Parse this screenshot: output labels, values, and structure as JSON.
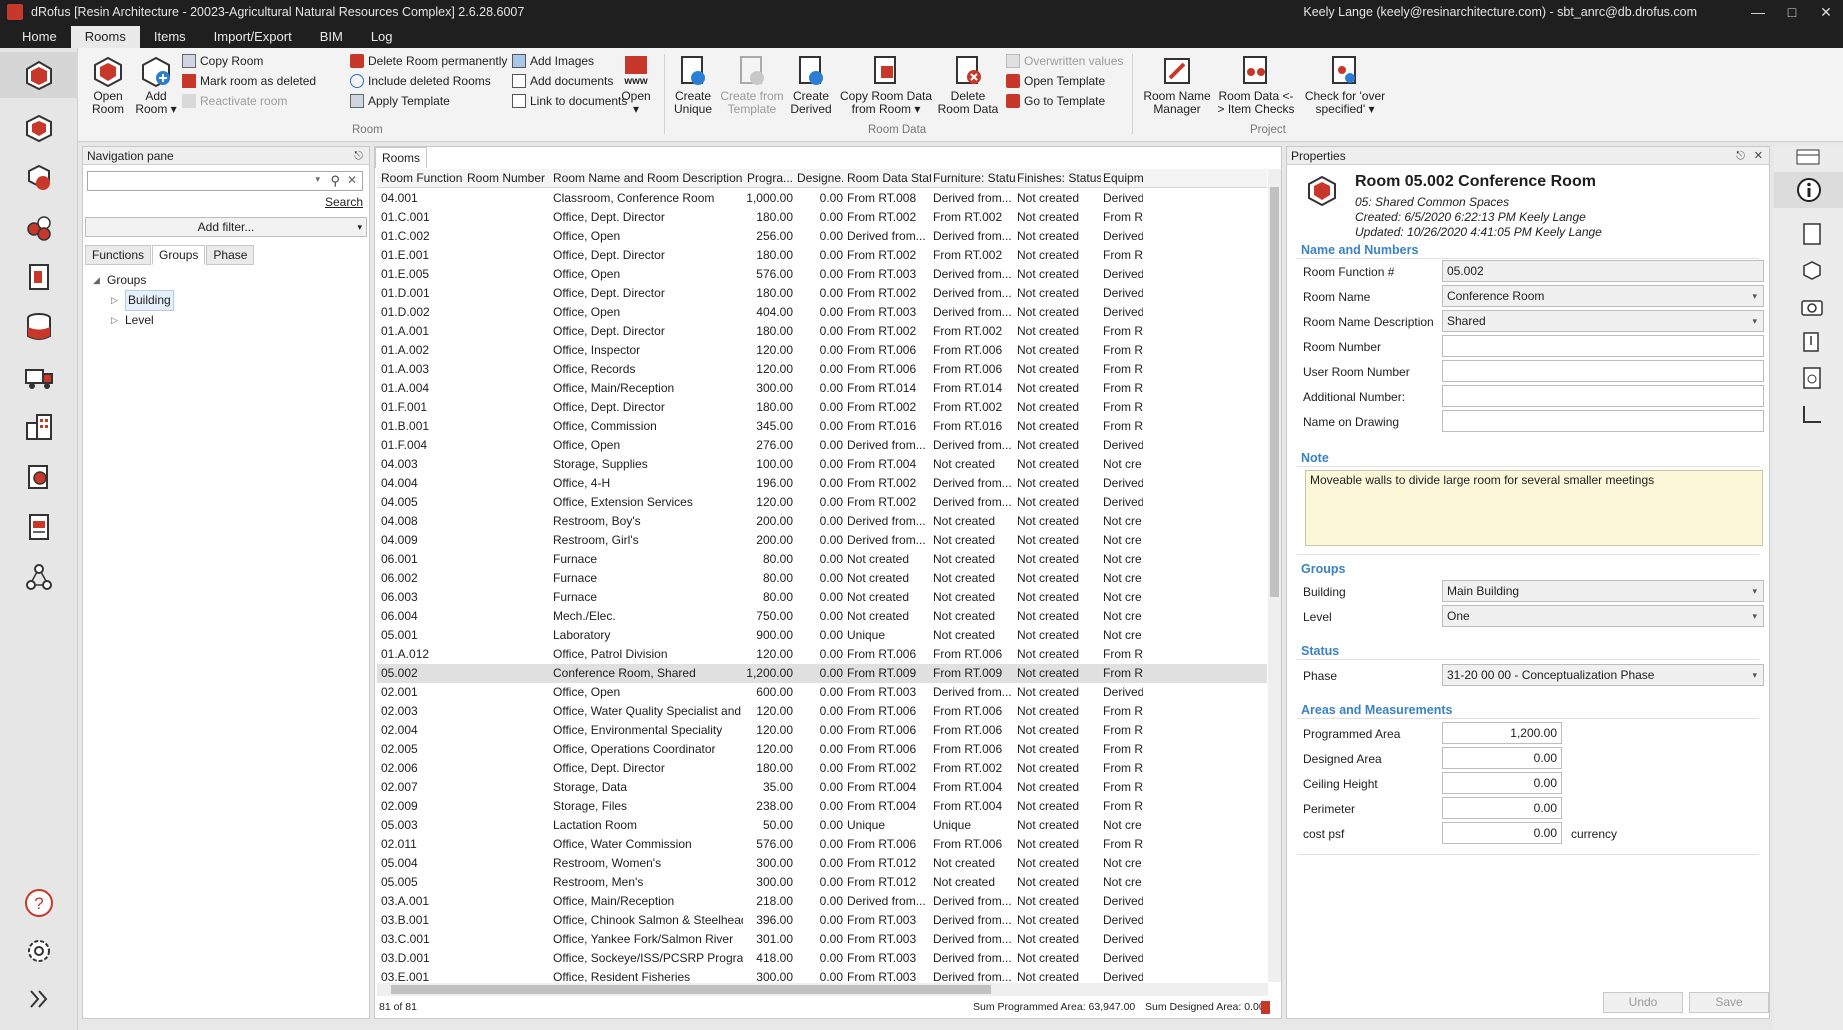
{
  "app": {
    "title": "dRofus [Resin Architecture - 20023-Agricultural Natural Resources Complex] 2.6.28.6007",
    "user": "Keely Lange (keely@resinarchitecture.com) - sbt_anrc@db.drofus.com",
    "brand_color": "#c8382a"
  },
  "menu": {
    "tabs": [
      "Home",
      "Rooms",
      "Items",
      "Import/Export",
      "BIM",
      "Log"
    ]
  },
  "ribbon": {
    "open_room": "Open Room",
    "add_room": "Add Room",
    "copy_room": "Copy Room",
    "mark_deleted": "Mark room as deleted",
    "reactivate": "Reactivate room",
    "delete_perm": "Delete Room permanently",
    "include_deleted": "Include deleted Rooms",
    "apply_template": "Apply Template",
    "add_images": "Add Images",
    "add_documents": "Add documents",
    "link_documents": "Link to documents",
    "www_open": "Open",
    "group_room": "Room",
    "create_unique": "Create Unique",
    "create_from_template": "Create from Template",
    "create_derived": "Create Derived",
    "copy_room_data": "Copy Room Data from Room",
    "delete_room_data": "Delete Room Data",
    "overwritten_values": "Overwritten values",
    "open_template": "Open Template",
    "go_to_template": "Go to Template",
    "group_room_data": "Room Data",
    "room_name_manager": "Room Name Manager",
    "room_data_item_checks": "Room Data <-> Item Checks",
    "check_over_specified": "Check for 'over specified'",
    "group_project": "Project"
  },
  "nav": {
    "title": "Navigation pane",
    "search_placeholder": "",
    "search_link": "Search",
    "add_filter": "Add filter...",
    "tabs": [
      "Functions",
      "Groups",
      "Phase"
    ],
    "tree_root": "Groups",
    "tree_items": [
      "Building",
      "Level"
    ]
  },
  "rooms": {
    "tab": "Rooms",
    "columns": [
      "Room Function #",
      "Room Number",
      "Room Name and Room Description",
      "Progra...",
      "Designe...",
      "Room Data Stat...",
      "Furniture: Status",
      "Finishes: Status",
      "Equipm"
    ],
    "rows": [
      [
        "04.001",
        "",
        "Classroom, Conference Room",
        "1,000.00",
        "0.00",
        "From RT.008",
        "Derived from...",
        "Not created",
        "Derived"
      ],
      [
        "01.C.001",
        "",
        "Office, Dept. Director",
        "180.00",
        "0.00",
        "From RT.002",
        "From RT.002",
        "Not created",
        "From R"
      ],
      [
        "01.C.002",
        "",
        "Office, Open",
        "256.00",
        "0.00",
        "Derived from...",
        "Derived from...",
        "Not created",
        "Derived"
      ],
      [
        "01.E.001",
        "",
        "Office, Dept. Director",
        "180.00",
        "0.00",
        "From RT.002",
        "From RT.002",
        "Not created",
        "From R"
      ],
      [
        "01.E.005",
        "",
        "Office, Open",
        "576.00",
        "0.00",
        "From RT.003",
        "Derived from...",
        "Not created",
        "Derived"
      ],
      [
        "01.D.001",
        "",
        "Office, Dept. Director",
        "180.00",
        "0.00",
        "From RT.002",
        "Derived from...",
        "Not created",
        "Derived"
      ],
      [
        "01.D.002",
        "",
        "Office, Open",
        "404.00",
        "0.00",
        "From RT.003",
        "Derived from...",
        "Not created",
        "Derived"
      ],
      [
        "01.A.001",
        "",
        "Office, Dept. Director",
        "180.00",
        "0.00",
        "From RT.002",
        "From RT.002",
        "Not created",
        "From R"
      ],
      [
        "01.A.002",
        "",
        "Office, Inspector",
        "120.00",
        "0.00",
        "From RT.006",
        "From RT.006",
        "Not created",
        "From R"
      ],
      [
        "01.A.003",
        "",
        "Office, Records",
        "120.00",
        "0.00",
        "From RT.006",
        "From RT.006",
        "Not created",
        "From R"
      ],
      [
        "01.A.004",
        "",
        "Office, Main/Reception",
        "300.00",
        "0.00",
        "From RT.014",
        "From RT.014",
        "Not created",
        "From R"
      ],
      [
        "01.F.001",
        "",
        "Office, Dept. Director",
        "180.00",
        "0.00",
        "From RT.002",
        "From RT.002",
        "Not created",
        "From R"
      ],
      [
        "01.B.001",
        "",
        "Office, Commission",
        "345.00",
        "0.00",
        "From RT.016",
        "From RT.016",
        "Not created",
        "From R"
      ],
      [
        "01.F.004",
        "",
        "Office, Open",
        "276.00",
        "0.00",
        "Derived from...",
        "Derived from...",
        "Not created",
        "Derived"
      ],
      [
        "04.003",
        "",
        "Storage, Supplies",
        "100.00",
        "0.00",
        "From RT.004",
        "Not created",
        "Not created",
        "Not cre"
      ],
      [
        "04.004",
        "",
        "Office, 4-H",
        "196.00",
        "0.00",
        "From RT.002",
        "Derived from...",
        "Not created",
        "Derived"
      ],
      [
        "04.005",
        "",
        "Office, Extension Services",
        "120.00",
        "0.00",
        "From RT.002",
        "Derived from...",
        "Not created",
        "Derived"
      ],
      [
        "04.008",
        "",
        "Restroom, Boy's",
        "200.00",
        "0.00",
        "Derived from...",
        "Not created",
        "Not created",
        "Not cre"
      ],
      [
        "04.009",
        "",
        "Restroom, Girl's",
        "200.00",
        "0.00",
        "Derived from...",
        "Not created",
        "Not created",
        "Not cre"
      ],
      [
        "06.001",
        "",
        "Furnace",
        "80.00",
        "0.00",
        "Not created",
        "Not created",
        "Not created",
        "Not cre"
      ],
      [
        "06.002",
        "",
        "Furnace",
        "80.00",
        "0.00",
        "Not created",
        "Not created",
        "Not created",
        "Not cre"
      ],
      [
        "06.003",
        "",
        "Furnace",
        "80.00",
        "0.00",
        "Not created",
        "Not created",
        "Not created",
        "Not cre"
      ],
      [
        "06.004",
        "",
        "Mech./Elec.",
        "750.00",
        "0.00",
        "Not created",
        "Not created",
        "Not created",
        "Not cre"
      ],
      [
        "05.001",
        "",
        "Laboratory",
        "900.00",
        "0.00",
        "Unique",
        "Not created",
        "Not created",
        "Not cre"
      ],
      [
        "01.A.012",
        "",
        "Office, Patrol Division",
        "120.00",
        "0.00",
        "From RT.006",
        "From RT.006",
        "Not created",
        "From R"
      ],
      [
        "05.002",
        "",
        "Conference Room, Shared",
        "1,200.00",
        "0.00",
        "From RT.009",
        "From RT.009",
        "Not created",
        "From R"
      ],
      [
        "02.001",
        "",
        "Office, Open",
        "600.00",
        "0.00",
        "From RT.003",
        "Derived from...",
        "Not created",
        "Derived"
      ],
      [
        "02.003",
        "",
        "Office, Water Quality Specialist and En...",
        "120.00",
        "0.00",
        "From RT.006",
        "From RT.006",
        "Not created",
        "From R"
      ],
      [
        "02.004",
        "",
        "Office, Environmental Speciality",
        "120.00",
        "0.00",
        "From RT.006",
        "From RT.006",
        "Not created",
        "From R"
      ],
      [
        "02.005",
        "",
        "Office, Operations Coordinator",
        "120.00",
        "0.00",
        "From RT.006",
        "From RT.006",
        "Not created",
        "From R"
      ],
      [
        "02.006",
        "",
        "Office, Dept. Director",
        "180.00",
        "0.00",
        "From RT.002",
        "From RT.002",
        "Not created",
        "From R"
      ],
      [
        "02.007",
        "",
        "Storage, Data",
        "35.00",
        "0.00",
        "From RT.004",
        "From RT.004",
        "Not created",
        "From R"
      ],
      [
        "02.009",
        "",
        "Storage, Files",
        "238.00",
        "0.00",
        "From RT.004",
        "From RT.004",
        "Not created",
        "From R"
      ],
      [
        "05.003",
        "",
        "Lactation Room",
        "50.00",
        "0.00",
        "Unique",
        "Unique",
        "Not created",
        "Not cre"
      ],
      [
        "02.011",
        "",
        "Office, Water Commission",
        "576.00",
        "0.00",
        "From RT.006",
        "From RT.006",
        "Not created",
        "From R"
      ],
      [
        "05.004",
        "",
        "Restroom, Women's",
        "300.00",
        "0.00",
        "From RT.012",
        "Not created",
        "Not created",
        "Not cre"
      ],
      [
        "05.005",
        "",
        "Restroom, Men's",
        "300.00",
        "0.00",
        "From RT.012",
        "Not created",
        "Not created",
        "Not cre"
      ],
      [
        "03.A.001",
        "",
        "Office, Main/Reception",
        "218.00",
        "0.00",
        "Derived from...",
        "Derived from...",
        "Not created",
        "Derived"
      ],
      [
        "03.B.001",
        "",
        "Office, Chinook Salmon & Steelhead P...",
        "396.00",
        "0.00",
        "From RT.003",
        "Derived from...",
        "Not created",
        "Derived"
      ],
      [
        "03.C.001",
        "",
        "Office, Yankee Fork/Salmon River",
        "301.00",
        "0.00",
        "From RT.003",
        "Derived from...",
        "Not created",
        "Derived"
      ],
      [
        "03.D.001",
        "",
        "Office, Sockeye/ISS/PCSRP Programs",
        "418.00",
        "0.00",
        "From RT.003",
        "Derived from...",
        "Not created",
        "Derived"
      ],
      [
        "03.E.001",
        "",
        "Office, Resident Fisheries",
        "300.00",
        "0.00",
        "From RT.003",
        "Derived from...",
        "Not created",
        "Derived"
      ]
    ],
    "selected_row": 25,
    "count": "81 of 81",
    "sum_programmed": "Sum Programmed Area: 63,947.00",
    "sum_designed": "Sum Designed Area: 0.00"
  },
  "props": {
    "title": "Properties",
    "room_title": "Room 05.002 Conference Room",
    "subtitle": "05: Shared Common Spaces",
    "created": "Created: 6/5/2020 6:22:13 PM Keely Lange",
    "updated": "Updated: 10/26/2020 4:41:05 PM Keely Lange",
    "sect_names": "Name and Numbers",
    "l_function": "Room Function #",
    "v_function": "05.002",
    "l_name": "Room Name",
    "v_name": "Conference Room",
    "l_desc": "Room Name Description",
    "v_desc": "Shared",
    "l_number": "Room Number",
    "v_number": "",
    "l_user_number": "User Room Number",
    "v_user_number": "",
    "l_additional": "Additional Number:",
    "v_additional": "",
    "l_drawing": "Name on Drawing",
    "v_drawing": "",
    "sect_note": "Note",
    "note": "Moveable walls to divide large room for several smaller meetings",
    "sect_groups": "Groups",
    "l_building": "Building",
    "v_building": "Main Building",
    "l_level": "Level",
    "v_level": "One",
    "sect_status": "Status",
    "l_phase": "Phase",
    "v_phase": "31-20 00 00 - Conceptualization Phase",
    "sect_areas": "Areas and Measurements",
    "l_programmed": "Programmed Area",
    "v_programmed": "1,200.00",
    "l_designed": "Designed Area",
    "v_designed": "0.00",
    "l_ceiling": "Ceiling Height",
    "v_ceiling": "0.00",
    "l_perimeter": "Perimeter",
    "v_perimeter": "0.00",
    "l_cost": "cost psf",
    "v_cost": "0.00",
    "cost_unit": "currency",
    "undo": "Undo",
    "save": "Save"
  }
}
